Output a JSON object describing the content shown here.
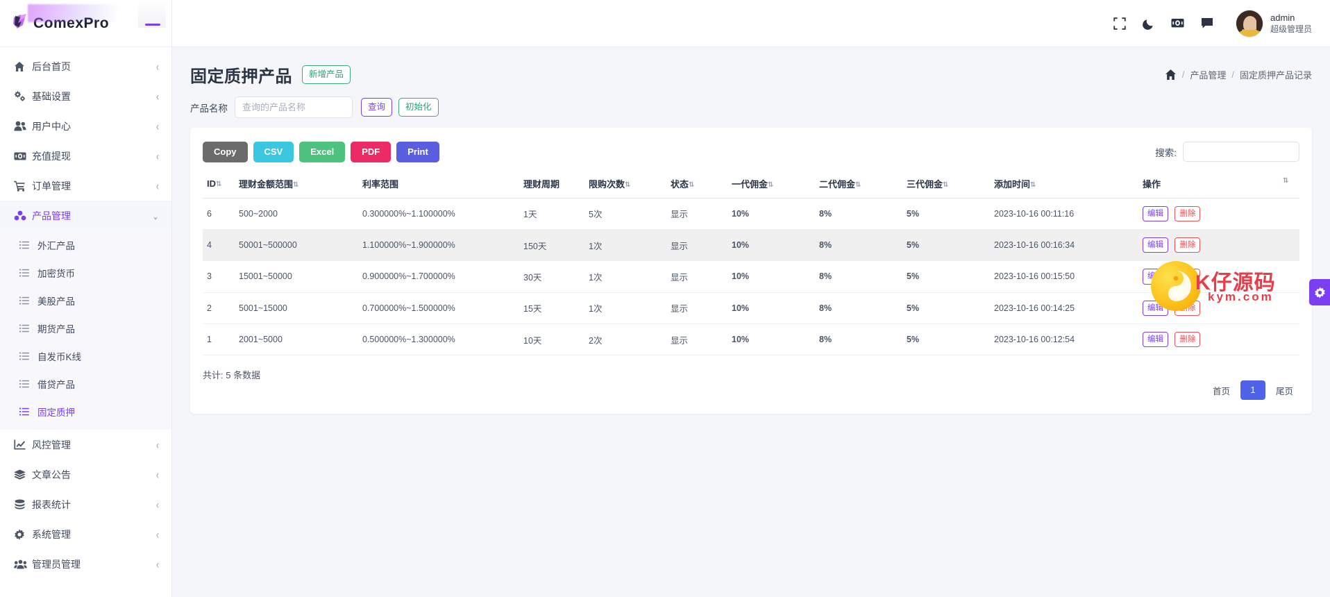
{
  "brand": {
    "name": "ComexPro"
  },
  "sidebar": {
    "items": [
      {
        "label": "后台首页",
        "icon": "home-icon",
        "arrow": "‹",
        "active": false
      },
      {
        "label": "基础设置",
        "icon": "gears-icon",
        "arrow": "‹",
        "active": false
      },
      {
        "label": "用户中心",
        "icon": "users-icon",
        "arrow": "‹",
        "active": false
      },
      {
        "label": "充值提现",
        "icon": "cash-icon",
        "arrow": "‹",
        "active": false
      },
      {
        "label": "订单管理",
        "icon": "cart-icon",
        "arrow": "‹",
        "active": false
      },
      {
        "label": "产品管理",
        "icon": "cubes-icon",
        "arrow": "⌄",
        "active": true
      }
    ],
    "submenu": [
      {
        "label": "外汇产品",
        "icon": "list-icon",
        "active": false
      },
      {
        "label": "加密货币",
        "icon": "list-icon",
        "active": false
      },
      {
        "label": "美股产品",
        "icon": "list-icon",
        "active": false
      },
      {
        "label": "期货产品",
        "icon": "list-icon",
        "active": false
      },
      {
        "label": "自发币K线",
        "icon": "list-icon",
        "active": false
      },
      {
        "label": "借贷产品",
        "icon": "list-icon",
        "active": false
      },
      {
        "label": "固定质押",
        "icon": "list-icon",
        "active": true
      }
    ],
    "items_after": [
      {
        "label": "风控管理",
        "icon": "chart-line-icon",
        "arrow": "‹"
      },
      {
        "label": "文章公告",
        "icon": "layers-icon",
        "arrow": "‹"
      },
      {
        "label": "报表统计",
        "icon": "coins-icon",
        "arrow": "‹"
      },
      {
        "label": "系统管理",
        "icon": "gear-icon",
        "arrow": "‹"
      },
      {
        "label": "管理员管理",
        "icon": "user-group-icon",
        "arrow": "‹"
      }
    ]
  },
  "topbar": {
    "icons": [
      "fullscreen-icon",
      "moon-icon",
      "money-icon",
      "chat-icon"
    ],
    "user": {
      "name": "admin",
      "role": "超级管理员"
    }
  },
  "page": {
    "title": "固定质押产品",
    "add_button": "新增产品",
    "breadcrumb": {
      "home": "home-icon",
      "sep": "/",
      "level1": "产品管理",
      "current": "固定质押产品记录"
    }
  },
  "filter": {
    "label": "产品名称",
    "placeholder": "查询的产品名称",
    "value": "",
    "query_button": "查询",
    "reset_button": "初始化"
  },
  "toolbar": {
    "export_buttons": [
      {
        "label": "Copy",
        "color": "#6b6b6b"
      },
      {
        "label": "CSV",
        "color": "#3bc7e0"
      },
      {
        "label": "Excel",
        "color": "#4dc37f"
      },
      {
        "label": "PDF",
        "color": "#ec2b66"
      },
      {
        "label": "Print",
        "color": "#5a5fe0"
      }
    ],
    "search_label": "搜索:",
    "search_value": "",
    "search_placeholder": ""
  },
  "table": {
    "columns": [
      {
        "label": "ID",
        "sortable": true
      },
      {
        "label": "理财金额范围",
        "sortable": true
      },
      {
        "label": "利率范围",
        "sortable": false
      },
      {
        "label": "理财周期",
        "sortable": false
      },
      {
        "label": "限购次数",
        "sortable": false
      },
      {
        "label": "状态",
        "sortable": true
      },
      {
        "label": "一代佣金",
        "sortable": true
      },
      {
        "label": "二代佣金",
        "sortable": true
      },
      {
        "label": "三代佣金",
        "sortable": true
      },
      {
        "label": "添加时间",
        "sortable": true
      },
      {
        "label": "操作",
        "sortable": true
      }
    ],
    "rows": [
      {
        "id": "6",
        "amount_range": "500~2000",
        "rate_range": "0.300000%~1.100000%",
        "period": "1天",
        "limit": "5次",
        "status": "显示",
        "c1": "10%",
        "c2": "8%",
        "c3": "5%",
        "created": "2023-10-16 00:11:16",
        "edit": "编辑",
        "delete": "删除"
      },
      {
        "id": "4",
        "amount_range": "50001~500000",
        "rate_range": "1.100000%~1.900000%",
        "period": "150天",
        "limit": "1次",
        "status": "显示",
        "c1": "10%",
        "c2": "8%",
        "c3": "5%",
        "created": "2023-10-16 00:16:34",
        "edit": "编辑",
        "delete": "删除"
      },
      {
        "id": "3",
        "amount_range": "15001~50000",
        "rate_range": "0.900000%~1.700000%",
        "period": "30天",
        "limit": "1次",
        "status": "显示",
        "c1": "10%",
        "c2": "8%",
        "c3": "5%",
        "created": "2023-10-16 00:15:50",
        "edit": "编辑",
        "delete": "删除"
      },
      {
        "id": "2",
        "amount_range": "5001~15000",
        "rate_range": "0.700000%~1.500000%",
        "period": "15天",
        "limit": "1次",
        "status": "显示",
        "c1": "10%",
        "c2": "8%",
        "c3": "5%",
        "created": "2023-10-16 00:14:25",
        "edit": "编辑",
        "delete": "删除"
      },
      {
        "id": "1",
        "amount_range": "2001~5000",
        "rate_range": "0.500000%~1.300000%",
        "period": "10天",
        "limit": "2次",
        "status": "显示",
        "c1": "10%",
        "c2": "8%",
        "c3": "5%",
        "created": "2023-10-16 00:12:54",
        "edit": "编辑",
        "delete": "删除"
      }
    ],
    "total_text": "共计: 5 条数据",
    "pagination": {
      "first": "首页",
      "current": "1",
      "last": "尾页"
    }
  },
  "watermark": {
    "title": "K仔源码",
    "subtitle": "kym.com"
  },
  "colors": {
    "accent": "#7b3ff2",
    "pager_active": "#4f63e8",
    "green": "#3aab7b",
    "danger": "#e8505b",
    "row_alt": "#f0f0f0"
  }
}
